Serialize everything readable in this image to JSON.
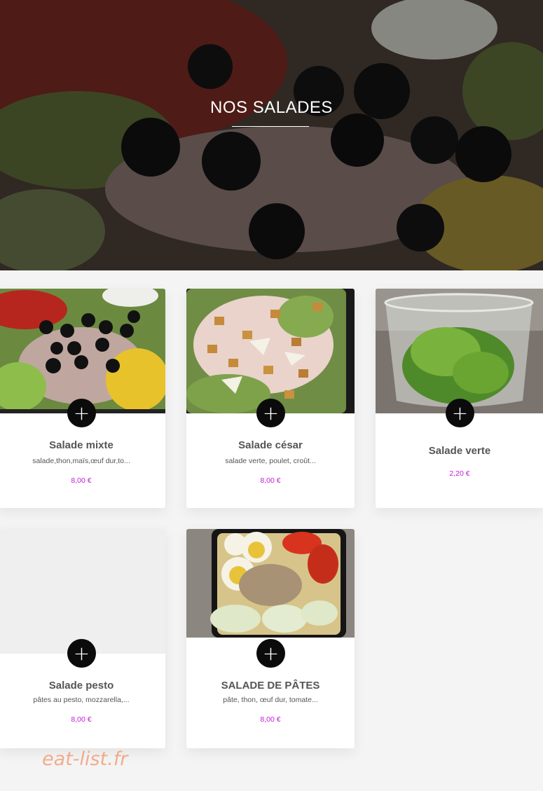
{
  "hero": {
    "title": "NOS SALADES"
  },
  "products": [
    {
      "name": "Salade mixte",
      "description": "salade,thon,maïs,œuf dur,to...",
      "price": "8,00 €"
    },
    {
      "name": "Salade césar",
      "description": "salade verte, poulet, croût...",
      "price": "8,00 €"
    },
    {
      "name": "Salade verte",
      "description": "",
      "price": "2,20 €"
    },
    {
      "name": "Salade pesto",
      "description": "pâtes au pesto, mozzarella,...",
      "price": "8,00 €"
    },
    {
      "name": "SALADE DE PÂTES",
      "description": "pâte, thon, œuf dur, tomate...",
      "price": "8,00 €"
    }
  ],
  "add_button_glyph": "+",
  "watermark": "eat-list.fr",
  "colors": {
    "price": "#c21bd6",
    "button": "#0b0b0b",
    "background": "#f4f4f4"
  }
}
